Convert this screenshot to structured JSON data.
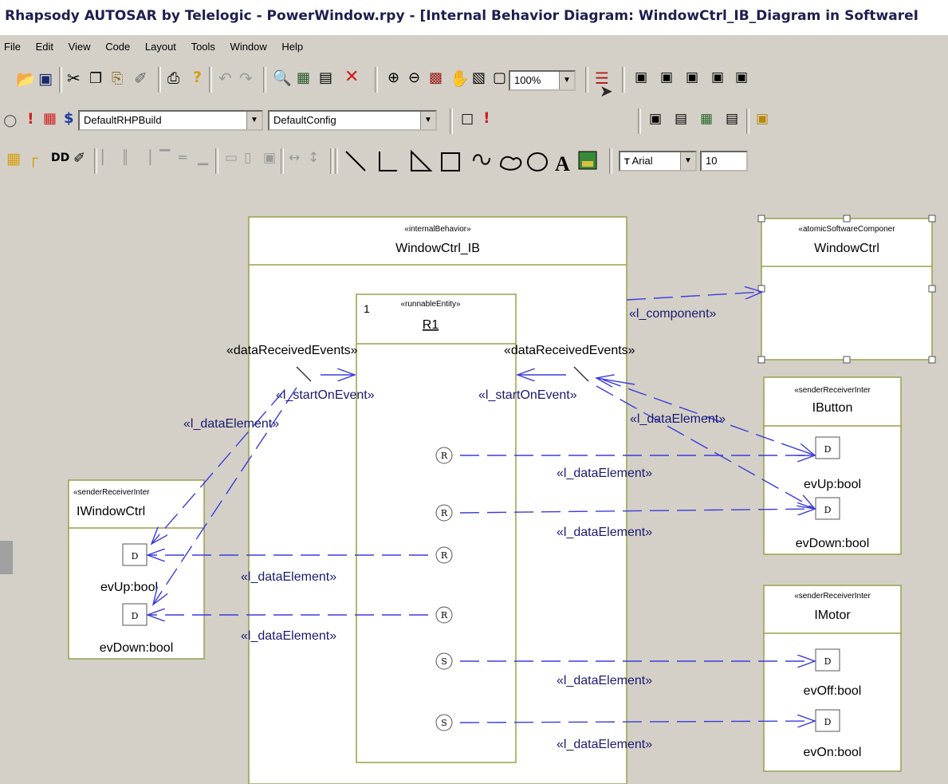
{
  "window": {
    "title": "Rhapsody AUTOSAR by Telelogic - PowerWindow.rpy - [Internal Behavior Diagram: WindowCtrl_IB_Diagram in SoftwareI"
  },
  "menu": [
    "File",
    "Edit",
    "View",
    "Code",
    "Layout",
    "Tools",
    "Window",
    "Help"
  ],
  "toolbar": {
    "zoom": "100%",
    "build_config": "DefaultRHPBuild",
    "config": "DefaultConfig",
    "font_name": "Arial",
    "font_size": "10"
  },
  "diagram": {
    "internal_behavior": {
      "stereotype": "«internalBehavior»",
      "name": "WindowCtrl_IB"
    },
    "runnable": {
      "multiplicity": "1",
      "stereotype": "«runnableEntity»",
      "name": "R1"
    },
    "component": {
      "stereotype": "«atomicSoftwareComponer",
      "name": "WindowCtrl"
    },
    "ibutton": {
      "stereotype": "«senderReceiverInter",
      "name": "IButton",
      "elements": [
        "evUp:bool",
        "evDown:bool"
      ]
    },
    "imotor": {
      "stereotype": "«senderReceiverInter",
      "name": "IMotor",
      "elements": [
        "evOff:bool",
        "evOn:bool"
      ]
    },
    "iwindow": {
      "stereotype": "«senderReceiverInter",
      "name": "IWindowCtrl",
      "elements": [
        "evUp:bool",
        "evDown:bool"
      ]
    },
    "port_letters": {
      "receive": "R",
      "send": "S",
      "data": "D"
    },
    "labels": {
      "component": "«l_component»",
      "data_received_events": "«dataReceivedEvents»",
      "start_on_event": "«l_startOnEvent»",
      "data_element": "«l_dataElement»"
    }
  },
  "colors": {
    "class_border": "#9aa04a",
    "class_fill": "#ffffff",
    "link": "#3b3bdc",
    "canvas": "#d4d0c8"
  }
}
